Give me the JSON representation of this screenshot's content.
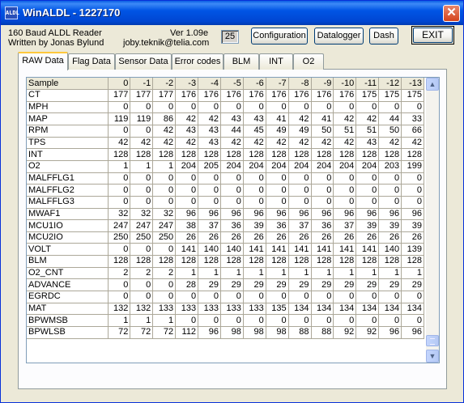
{
  "window": {
    "title": "WinALDL - 1227170",
    "app_icon": "ALDL",
    "close_glyph": "✕"
  },
  "header": {
    "line1": "160 Baud ALDL Reader",
    "line2": "Written by Jonas Bylund",
    "version": "Ver 1.09e",
    "email": "joby.teknik@telia.com",
    "number": "25"
  },
  "buttons": {
    "configuration": "Configuration",
    "datalogger": "Datalogger",
    "dash": "Dash",
    "exit": "EXIT"
  },
  "tabs": [
    "RAW Data",
    "Flag Data",
    "Sensor Data",
    "Error codes",
    "BLM",
    "INT",
    "O2"
  ],
  "grid": {
    "header_label": "Sample",
    "columns": [
      "0",
      "-1",
      "-2",
      "-3",
      "-4",
      "-5",
      "-6",
      "-7",
      "-8",
      "-9",
      "-10",
      "-11",
      "-12",
      "-13"
    ],
    "rows": [
      {
        "label": "CT",
        "values": [
          177,
          177,
          177,
          176,
          176,
          176,
          176,
          176,
          176,
          176,
          176,
          175,
          175,
          175
        ]
      },
      {
        "label": "MPH",
        "values": [
          0,
          0,
          0,
          0,
          0,
          0,
          0,
          0,
          0,
          0,
          0,
          0,
          0,
          0
        ]
      },
      {
        "label": "MAP",
        "values": [
          119,
          119,
          86,
          42,
          42,
          43,
          43,
          41,
          42,
          41,
          42,
          42,
          44,
          33
        ]
      },
      {
        "label": "RPM",
        "values": [
          0,
          0,
          42,
          43,
          43,
          44,
          45,
          49,
          49,
          50,
          51,
          51,
          50,
          66
        ]
      },
      {
        "label": "TPS",
        "values": [
          42,
          42,
          42,
          42,
          43,
          42,
          42,
          42,
          42,
          42,
          42,
          43,
          42,
          42
        ]
      },
      {
        "label": "INT",
        "values": [
          128,
          128,
          128,
          128,
          128,
          128,
          128,
          128,
          128,
          128,
          128,
          128,
          128,
          128
        ]
      },
      {
        "label": "O2",
        "values": [
          1,
          1,
          1,
          204,
          205,
          204,
          204,
          204,
          204,
          204,
          204,
          204,
          203,
          199
        ]
      },
      {
        "label": "MALFFLG1",
        "values": [
          0,
          0,
          0,
          0,
          0,
          0,
          0,
          0,
          0,
          0,
          0,
          0,
          0,
          0
        ]
      },
      {
        "label": "MALFFLG2",
        "values": [
          0,
          0,
          0,
          0,
          0,
          0,
          0,
          0,
          0,
          0,
          0,
          0,
          0,
          0
        ]
      },
      {
        "label": "MALFFLG3",
        "values": [
          0,
          0,
          0,
          0,
          0,
          0,
          0,
          0,
          0,
          0,
          0,
          0,
          0,
          0
        ]
      },
      {
        "label": "MWAF1",
        "values": [
          32,
          32,
          32,
          96,
          96,
          96,
          96,
          96,
          96,
          96,
          96,
          96,
          96,
          96
        ]
      },
      {
        "label": "MCU1IO",
        "values": [
          247,
          247,
          247,
          38,
          37,
          36,
          39,
          36,
          37,
          36,
          37,
          39,
          39,
          39
        ]
      },
      {
        "label": "MCU2IO",
        "values": [
          250,
          250,
          250,
          26,
          26,
          26,
          26,
          26,
          26,
          26,
          26,
          26,
          26,
          26
        ]
      },
      {
        "label": "VOLT",
        "values": [
          0,
          0,
          0,
          141,
          140,
          140,
          141,
          141,
          141,
          141,
          141,
          141,
          140,
          139
        ]
      },
      {
        "label": "BLM",
        "values": [
          128,
          128,
          128,
          128,
          128,
          128,
          128,
          128,
          128,
          128,
          128,
          128,
          128,
          128
        ]
      },
      {
        "label": "O2_CNT",
        "values": [
          2,
          2,
          2,
          1,
          1,
          1,
          1,
          1,
          1,
          1,
          1,
          1,
          1,
          1
        ]
      },
      {
        "label": "ADVANCE",
        "values": [
          0,
          0,
          0,
          28,
          29,
          29,
          29,
          29,
          29,
          29,
          29,
          29,
          29,
          29
        ]
      },
      {
        "label": "EGRDC",
        "values": [
          0,
          0,
          0,
          0,
          0,
          0,
          0,
          0,
          0,
          0,
          0,
          0,
          0,
          0
        ]
      },
      {
        "label": "MAT",
        "values": [
          132,
          132,
          133,
          133,
          133,
          133,
          133,
          135,
          134,
          134,
          134,
          134,
          134,
          134
        ]
      },
      {
        "label": "BPWMSB",
        "values": [
          1,
          1,
          1,
          0,
          0,
          0,
          0,
          0,
          0,
          0,
          0,
          0,
          0,
          0
        ]
      },
      {
        "label": "BPWLSB",
        "values": [
          72,
          72,
          72,
          112,
          96,
          98,
          98,
          98,
          88,
          88,
          92,
          92,
          96,
          96
        ]
      }
    ]
  },
  "scrollbar": {
    "up_glyph": "▲",
    "down_glyph": "▼"
  }
}
